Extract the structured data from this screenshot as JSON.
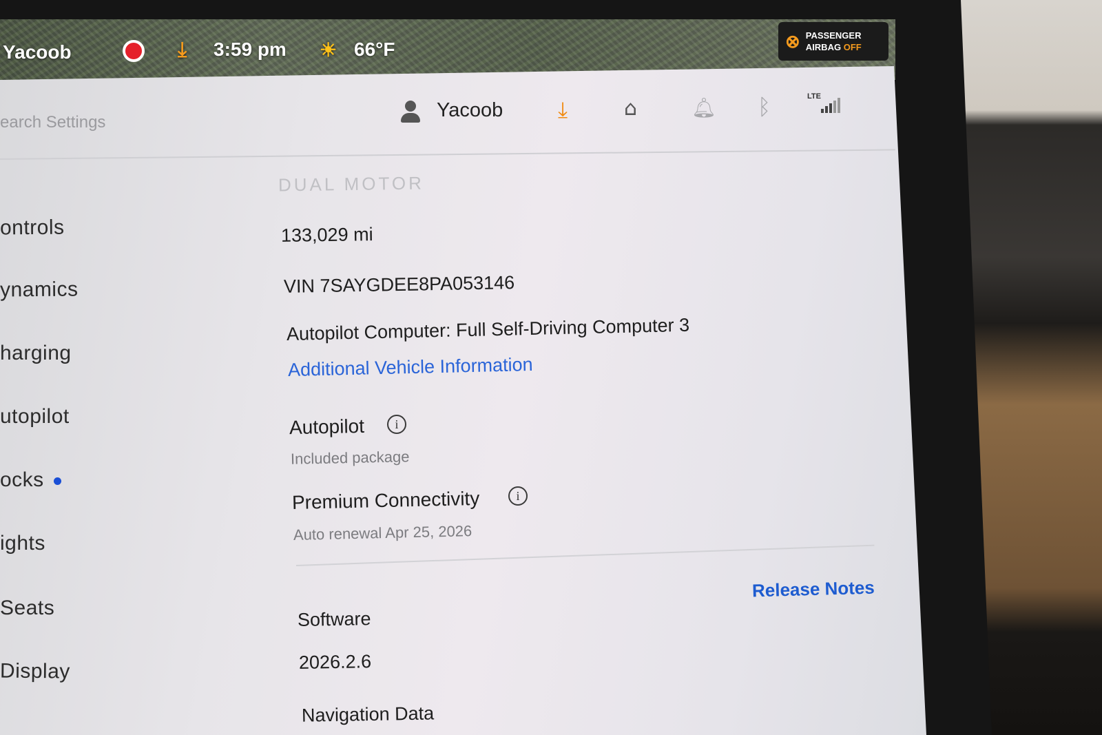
{
  "status_bar": {
    "user": "Yacoob",
    "time": "3:59 pm",
    "temperature": "66°F",
    "airbag": {
      "line1": "PASSENGER",
      "line2_prefix": "AIRBAG",
      "line2_state": "OFF"
    }
  },
  "header": {
    "search_placeholder": "earch Settings",
    "user": "Yacoob",
    "network": "LTE"
  },
  "sidebar": {
    "items": [
      {
        "label": "ontrols"
      },
      {
        "label": "ynamics"
      },
      {
        "label": "harging"
      },
      {
        "label": "utopilot"
      },
      {
        "label": "ocks",
        "badge": true
      },
      {
        "label": "ights"
      },
      {
        "label": "Seats"
      },
      {
        "label": "Display"
      }
    ]
  },
  "vehicle": {
    "model": "DUAL MOTOR",
    "odometer": "133,029  mi",
    "vin": "VIN 7SAYGDEE8PA053146",
    "computer": "Autopilot Computer: Full Self-Driving Computer 3",
    "more_info_link": "Additional Vehicle Information",
    "autopilot": {
      "title": "Autopilot",
      "subtitle": "Included package"
    },
    "connectivity": {
      "title": "Premium Connectivity",
      "subtitle": "Auto renewal Apr 25, 2026"
    }
  },
  "software": {
    "release_notes_link": "Release Notes",
    "title": "Software",
    "version": "2026.2.6",
    "navigation_title": "Navigation Data"
  },
  "colors": {
    "accent_blue": "#2a64d8",
    "warning_orange": "#f59b1e",
    "record_red": "#e5202a"
  }
}
